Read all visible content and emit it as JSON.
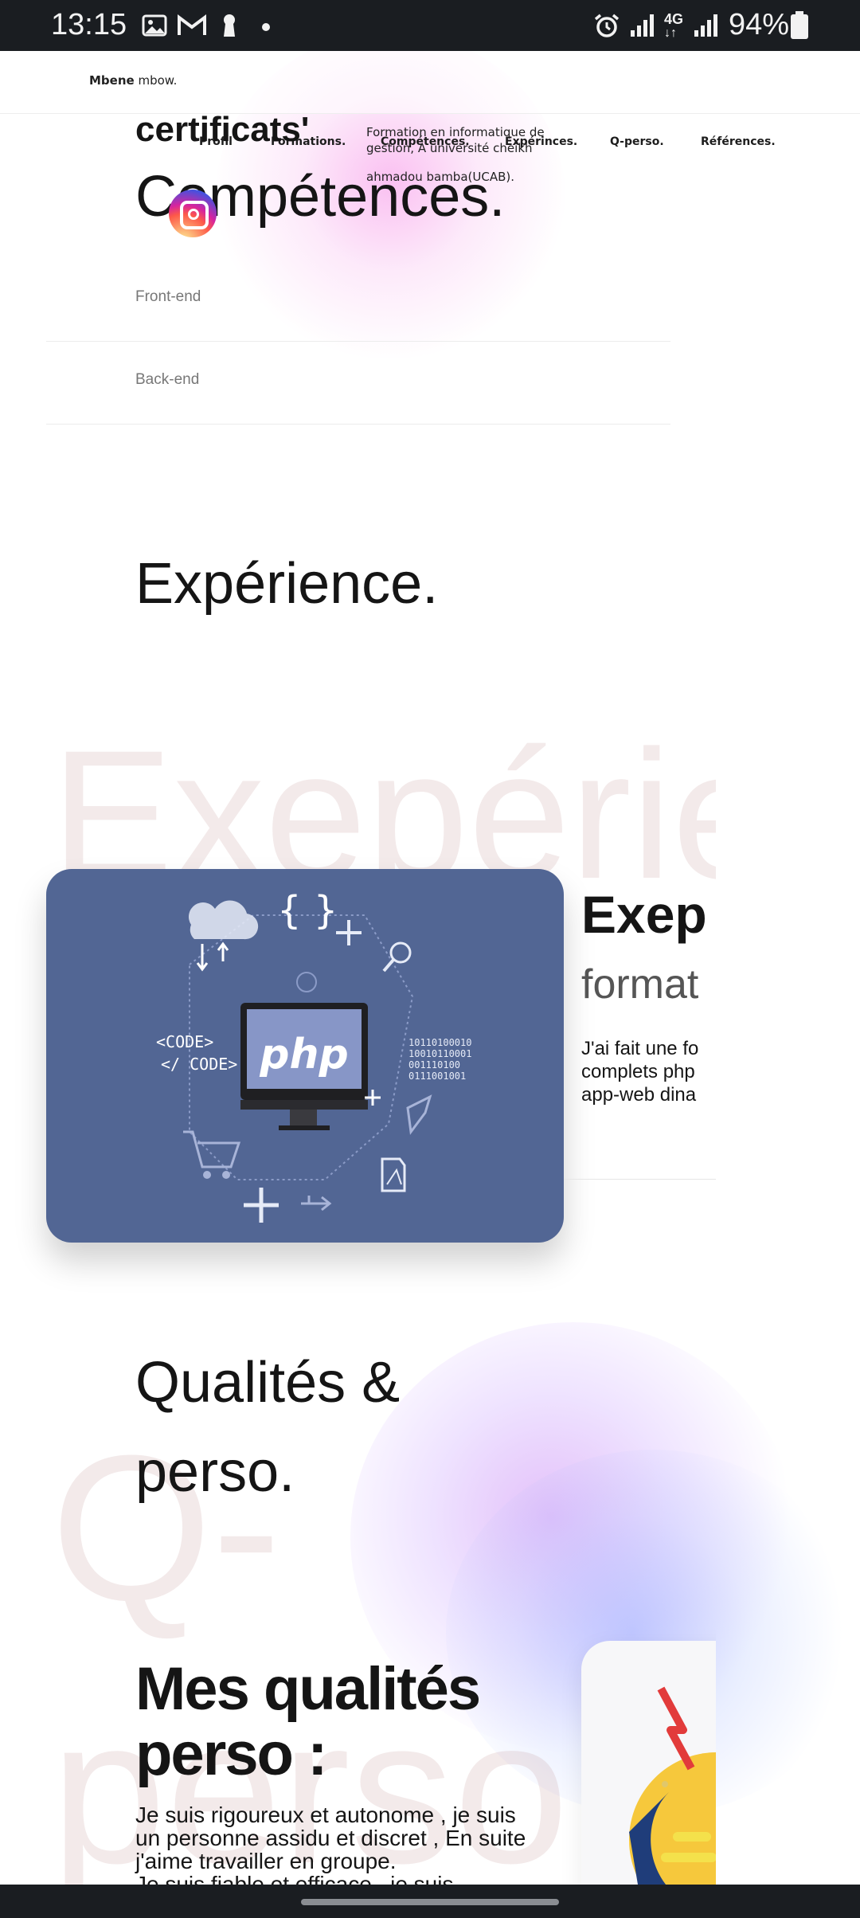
{
  "status_bar": {
    "time": "13:15",
    "battery": "94%",
    "network": "4G",
    "icons": [
      "image-icon",
      "gmail-icon",
      "keyhole-icon",
      "dot-icon",
      "alarm-icon",
      "signal-icon",
      "signal-icon",
      "battery-icon"
    ]
  },
  "header": {
    "brand_first": "Mbene",
    "brand_last": " mbow.",
    "nav": [
      "Profil",
      "Formations.",
      "Compétences.",
      "Expérinces.",
      "Q-perso.",
      "Références."
    ]
  },
  "overlap": {
    "certificats": "certificats'",
    "formation_text_line1": "Formation en informatique de",
    "formation_text_line2": "gestion, A université cheikh",
    "formation_text_line3": "ahmadou bamba(UCAB)."
  },
  "competences": {
    "title": "Compétences.",
    "items": [
      "Front-end",
      "Back-end"
    ]
  },
  "experience": {
    "title": "Expérience.",
    "ghost_text": "Exepérie",
    "card_heading": "Exep",
    "card_subheading": "format",
    "card_text_line1": "J'ai fait une fo",
    "card_text_line2": "complets php",
    "card_text_line3": "app-web dina",
    "illustration": {
      "php_label": "php",
      "code_open": "<CODE>",
      "code_close": "</ CODE>",
      "binary": [
        "10110100010",
        "10010110001",
        "001110100",
        "0111001001"
      ],
      "braces": "{ }"
    }
  },
  "qualites": {
    "title_line1": "Qualités &",
    "title_line2": "perso.",
    "ghost_q": "Q-",
    "ghost_perso": "perso",
    "subtitle_line1": "Mes qualités",
    "subtitle_line2": "perso :",
    "body_line1": "Je suis rigoureux et autonome , je suis",
    "body_line2": "un personne assidu et discret , En suite",
    "body_line3": "j'aime travailler en groupe.",
    "body_line4": "Je suis fiable et efficace , je suis"
  },
  "colors": {
    "card_bg": "#526694",
    "pink_blob": "#f4a7e6",
    "blue_blob": "#a9b6ff",
    "ghost": "#e7d7d7"
  }
}
